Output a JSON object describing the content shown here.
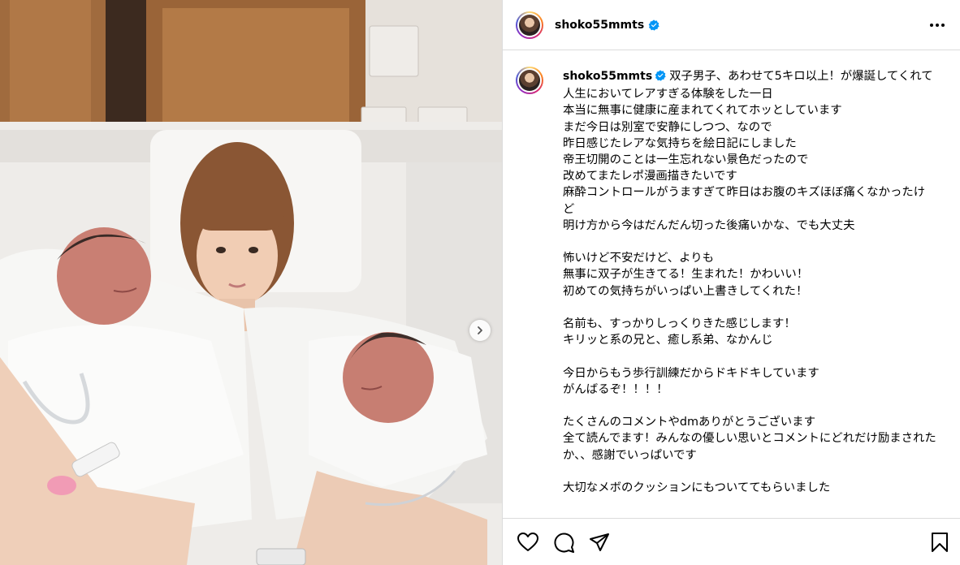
{
  "post": {
    "username": "shoko55mmts",
    "caption_lines": [
      "双子男子、あわせて5キロ以上！が爆誕してくれて",
      "人生においてレアすぎる体験をした一日",
      "本当に無事に健康に産まれてくれてホッとしています",
      "まだ今日は別室で安静にしつつ、なので",
      "昨日感じたレアな気持ちを絵日記にしました",
      "帝王切開のことは一生忘れない景色だったので",
      "改めてまたレポ漫画描きたいです",
      "麻酔コントロールがうますぎて昨日はお腹のキズほぼ痛くなかったけど",
      "明け方から今はだんだん切った後痛いかな、でも大丈夫",
      "",
      "怖いけど不安だけど、よりも",
      "無事に双子が生きてる！生まれた！かわいい！",
      "初めての気持ちがいっぱい上書きしてくれた！",
      "",
      "名前も、すっかりしっくりきた感じします！",
      "キリッと系の兄と、癒し系弟、なかんじ",
      "",
      "今日からもう歩行訓練だからドキドキしています",
      "がんばるぞ！！！！",
      "",
      "たくさんのコメントやdmありがとうございます",
      "全て読んでます！みんなの優しい思いとコメントにどれだけ励まされたか、、感謝でいっぱいです",
      "",
      "大切なメボのクッションにもついててもらいました"
    ]
  },
  "icons": {
    "verified": "verified-badge-icon",
    "more": "more-horizontal-icon",
    "like": "heart-icon",
    "comment": "comment-bubble-icon",
    "share": "paper-plane-icon",
    "save": "bookmark-icon",
    "next": "chevron-right-icon"
  },
  "colors": {
    "verified_blue": "#0095f6",
    "border": "#dbdbdb"
  }
}
